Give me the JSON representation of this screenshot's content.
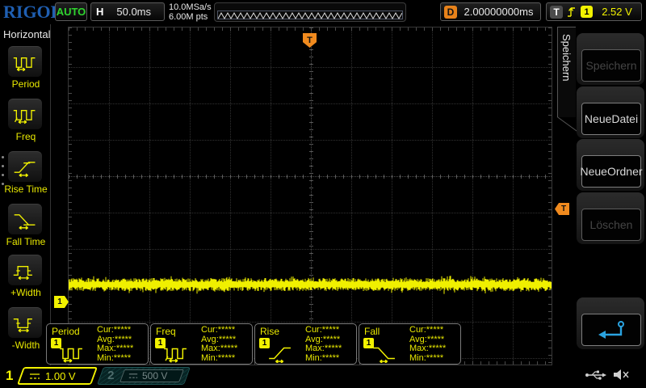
{
  "top_bar": {
    "logo": "RIGOL",
    "acq_status": "AUTO",
    "horizontal": {
      "label": "H",
      "timebase": "50.0ms"
    },
    "sample_rate": "10.0MSa/s",
    "memory_depth": "6.00M pts",
    "delay": {
      "label": "D",
      "value": "2.00000000ms"
    },
    "trigger": {
      "label": "T",
      "source": "1",
      "level": "2.52 V"
    }
  },
  "left_menu": {
    "title": "Horizontal",
    "items": [
      {
        "label": "Period"
      },
      {
        "label": "Freq"
      },
      {
        "label": "Rise Time"
      },
      {
        "label": "Fall Time"
      },
      {
        "label": "+Width"
      },
      {
        "label": "-Width"
      }
    ]
  },
  "right_menu": {
    "tab": "Speichern",
    "buttons": [
      {
        "label": "Speichern",
        "enabled": false
      },
      {
        "label": "NeueDatei",
        "enabled": true
      },
      {
        "label": "NeueOrdner",
        "enabled": true
      },
      {
        "label": "Löschen",
        "enabled": false
      },
      {
        "label": "",
        "icon": "return-arrow",
        "enabled": true
      }
    ]
  },
  "measurements": {
    "labels": {
      "cur": "Cur:",
      "avg": "Avg:",
      "max": "Max:",
      "min": "Min:"
    },
    "items": [
      {
        "name": "Period",
        "channel": "1",
        "cur": "*****",
        "avg": "*****",
        "max": "*****",
        "min": "*****"
      },
      {
        "name": "Freq",
        "channel": "1",
        "cur": "*****",
        "avg": "*****",
        "max": "*****",
        "min": "*****"
      },
      {
        "name": "Rise",
        "channel": "1",
        "cur": "*****",
        "avg": "*****",
        "max": "*****",
        "min": "*****"
      },
      {
        "name": "Fall",
        "channel": "1",
        "cur": "*****",
        "avg": "*****",
        "max": "*****",
        "min": "*****"
      }
    ]
  },
  "markers": {
    "trigger_position": "T",
    "trigger_level": "T",
    "channel1": "1"
  },
  "channels": [
    {
      "number": "1",
      "scale": "1.00 V",
      "coupling": "DC",
      "selected": true
    },
    {
      "number": "2",
      "scale": "500 V",
      "coupling": "DC",
      "selected": false
    }
  ],
  "colors": {
    "channel1": "#f2f200",
    "channel2": "#1e5454",
    "trigger_orange": "#f08a1e",
    "auto_green": "#2fd42f",
    "logo_blue": "#1f5fb2",
    "return_blue": "#2aa3e0"
  }
}
